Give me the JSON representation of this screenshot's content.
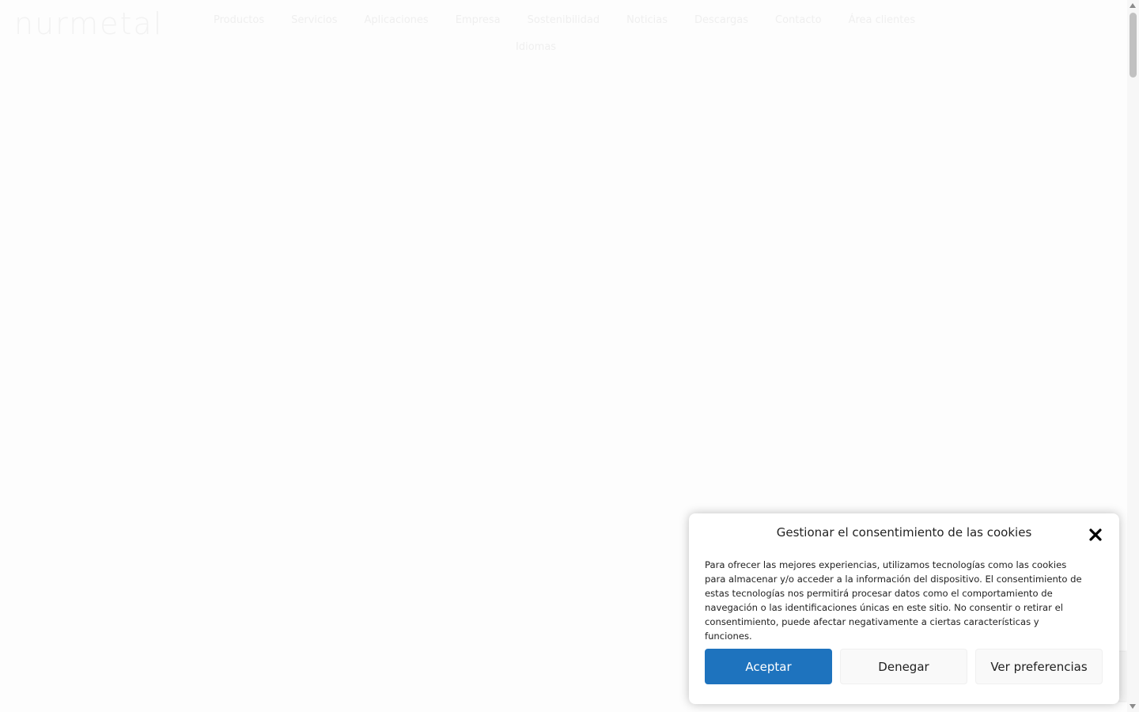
{
  "site": {
    "logo_text": "nurmetal",
    "nav": [
      "Productos",
      "Servicios",
      "Aplicaciones",
      "Empresa",
      "Sostenibilidad",
      "Noticias",
      "Descargas",
      "Contacto",
      "Área clientes"
    ],
    "nav_row2": "Idiomas"
  },
  "cookie_dialog": {
    "title": "Gestionar el consentimiento de las cookies",
    "body": "Para ofrecer las mejores experiencias, utilizamos tecnologías como las cookies para almacenar y/o acceder a la información del dispositivo. El consentimiento de estas tecnologías nos permitirá procesar datos como el comportamiento de navegación o las identificaciones únicas en este sitio. No consentir o retirar el consentimiento, puede afectar negativamente a ciertas características y funciones.",
    "accept_label": "Aceptar",
    "deny_label": "Denegar",
    "prefs_label": "Ver preferencias",
    "close_icon": "close-icon"
  },
  "colors": {
    "accent": "#1e73be",
    "background": "#fdfdfd"
  }
}
